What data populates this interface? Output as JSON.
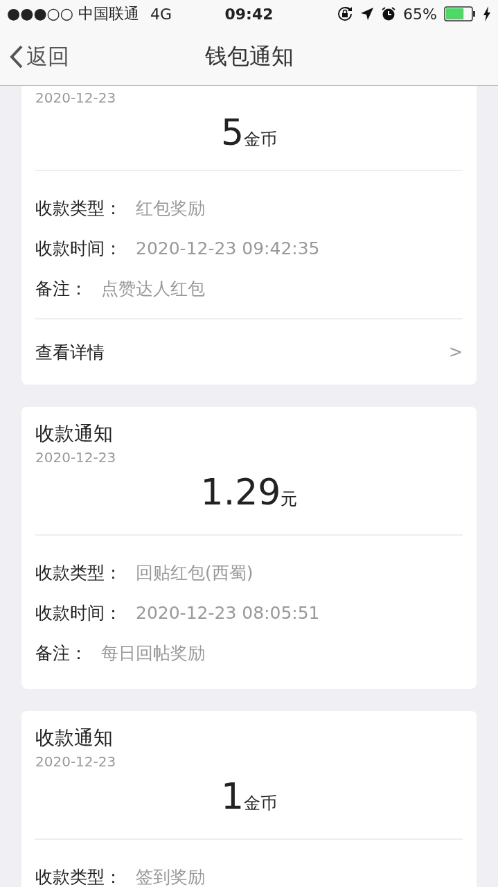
{
  "status_bar": {
    "carrier": "●●●○○ 中国联通",
    "network": "4G",
    "time": "09:42",
    "battery_percent": "65%"
  },
  "nav": {
    "back_label": "返回",
    "title": "钱包通知"
  },
  "cards": [
    {
      "date": "2020-12-23",
      "amount": "5",
      "unit": "金币",
      "fields": [
        {
          "label": "收款类型：",
          "value": "红包奖励"
        },
        {
          "label": "收款时间：",
          "value": "2020-12-23 09:42:35"
        },
        {
          "label": "备注：",
          "value": "点赞达人红包"
        }
      ],
      "detail": {
        "label": "查看详情",
        "chevron": ">"
      }
    },
    {
      "title": "收款通知",
      "date": "2020-12-23",
      "amount": "1.29",
      "unit": "元",
      "fields": [
        {
          "label": "收款类型：",
          "value": "回贴红包(西蜀)"
        },
        {
          "label": "收款时间：",
          "value": "2020-12-23 08:05:51"
        },
        {
          "label": "备注：",
          "value": "每日回帖奖励"
        }
      ]
    },
    {
      "title": "收款通知",
      "date": "2020-12-23",
      "amount": "1",
      "unit": "金币",
      "fields": [
        {
          "label": "收款类型：",
          "value": "签到奖励"
        }
      ]
    }
  ]
}
